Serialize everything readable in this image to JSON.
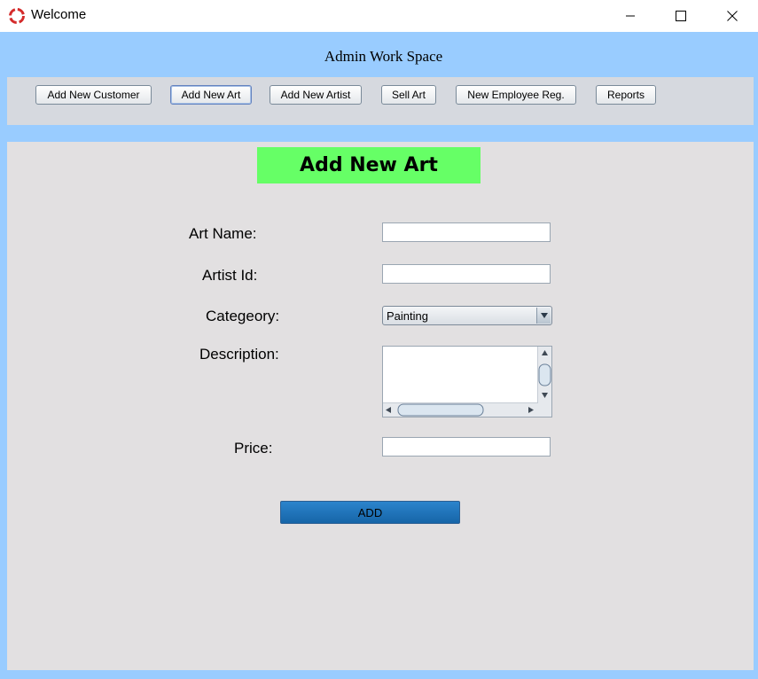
{
  "window": {
    "title": "Welcome",
    "controls": [
      "minimize",
      "maximize",
      "close"
    ]
  },
  "header": {
    "title": "Admin Work Space"
  },
  "toolbar": {
    "buttons": [
      {
        "label": "Add New Customer",
        "active": false
      },
      {
        "label": "Add New Art",
        "active": true
      },
      {
        "label": "Add New Artist",
        "active": false
      },
      {
        "label": "Sell Art",
        "active": false
      },
      {
        "label": "New Employee Reg.",
        "active": false
      },
      {
        "label": "Reports",
        "active": false
      }
    ]
  },
  "form": {
    "heading": "Add New Art",
    "art_name": {
      "label": "Art Name:",
      "value": ""
    },
    "artist_id": {
      "label": "Artist Id:",
      "value": ""
    },
    "category": {
      "label": "Categeory:",
      "value": "Painting"
    },
    "description": {
      "label": "Description:",
      "value": ""
    },
    "price": {
      "label": "Price:",
      "value": ""
    },
    "submit_label": "ADD"
  },
  "colors": {
    "frame": "#99ccff",
    "toolbar": "#d6d9df",
    "panel": "#e2e0e1",
    "heading_bg": "#66ff66",
    "add_button": "#1f74bb"
  },
  "icons": [
    "app-icon",
    "minimize-icon",
    "maximize-icon",
    "close-icon",
    "dropdown-arrow-icon",
    "scroll-up-icon",
    "scroll-down-icon",
    "scroll-left-icon",
    "scroll-right-icon"
  ]
}
